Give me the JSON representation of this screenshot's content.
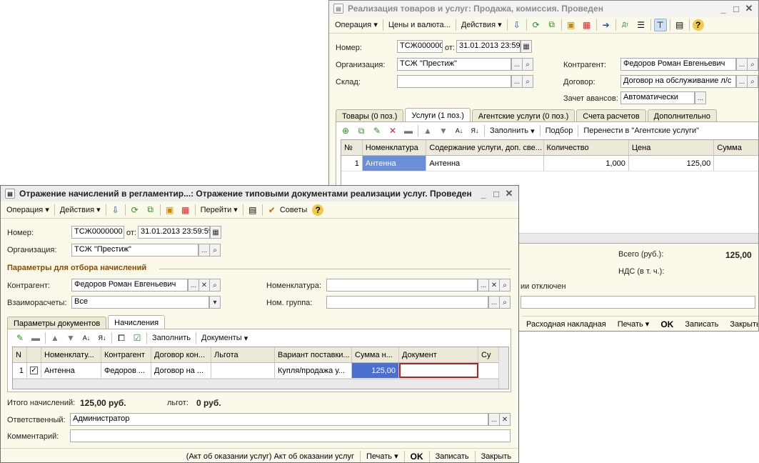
{
  "win1": {
    "title": "Реализация товаров и услуг: Продажа, комиссия. Проведен",
    "toolbar": {
      "operation": "Операция",
      "prices": "Цены и валюта...",
      "actions": "Действия"
    },
    "number_label": "Номер:",
    "number": "ТСЖ000000",
    "date_label": "от:",
    "date": "31.01.2013 23:59",
    "org_label": "Организация:",
    "org": "ТСЖ \"Престиж\"",
    "warehouse_label": "Склад:",
    "contractor_label": "Контрагент:",
    "contractor": "Федоров Роман Евгеньевич",
    "contract_label": "Договор:",
    "contract": "Договор на обслуживание л/с",
    "advance_label": "Зачет авансов:",
    "advance": "Автоматически",
    "tabs": [
      "Товары (0 поз.)",
      "Услуги (1 поз.)",
      "Агентские услуги (0 поз.)",
      "Счета расчетов",
      "Дополнительно"
    ],
    "grid_toolbar": {
      "fill": "Заполнить",
      "selection": "Подбор",
      "transfer": "Перенести в \"Агентские услуги\""
    },
    "grid_headers": [
      "№",
      "Номенклатура",
      "Содержание услуги, доп. све...",
      "Количество",
      "Цена",
      "Сумма"
    ],
    "grid_rows": [
      {
        "n": "1",
        "item": "Антенна",
        "content": "Антенна",
        "qty": "1,000",
        "price": "125,00"
      }
    ],
    "total_label": "Всего (руб.):",
    "total": "125,00",
    "vat_label": "НДС (в т. ч.):",
    "vat_note": "ии отключен",
    "bottom": {
      "invoice": "Расходная накладная",
      "print": "Печать",
      "ok": "OK",
      "save": "Записать",
      "close": "Закрыть"
    }
  },
  "win2": {
    "title": "Отражение начислений в регламентир...: Отражение типовыми документами реализации услуг. Проведен",
    "toolbar": {
      "operation": "Операция",
      "actions": "Действия",
      "goto": "Перейти",
      "tips": "Советы"
    },
    "number_label": "Номер:",
    "number": "ТСЖ0000000",
    "date_label": "от:",
    "date": "31.01.2013 23:59:59",
    "org_label": "Организация:",
    "org": "ТСЖ \"Престиж\"",
    "section": "Параметры для отбора начислений",
    "contractor_label": "Контрагент:",
    "contractor": "Федоров Роман Евгеньевич",
    "settlements_label": "Взаиморасчеты:",
    "settlements": "Все",
    "nomenclature_label": "Номенклатура:",
    "nomgroup_label": "Ном. группа:",
    "tabs": [
      "Параметры документов",
      "Начисления"
    ],
    "grid_toolbar": {
      "fill": "Заполнить",
      "documents": "Документы"
    },
    "grid_headers": [
      "N",
      "",
      "Номенклату...",
      "Контрагент",
      "Договор кон...",
      "Льгота",
      "Вариант поставки...",
      "Сумма н...",
      "Документ",
      "Су"
    ],
    "grid_rows": [
      {
        "n": "1",
        "item": "Антенна",
        "contractor": "Федоров ...",
        "contract": "Договор на ...",
        "benefit": "",
        "variant": "Купля/продажа у...",
        "sum": "125,00",
        "doc": ""
      }
    ],
    "totals_label": "Итого начислений:",
    "totals": "125,00 руб.",
    "benefits_label": "льгот:",
    "benefits": "0 руб.",
    "responsible_label": "Ответственный:",
    "responsible": "Администратор",
    "comment_label": "Комментарий:",
    "bottom": {
      "act": "(Акт об оказании услуг) Акт об оказании услуг",
      "print": "Печать",
      "ok": "OK",
      "save": "Записать",
      "close": "Закрыть"
    }
  }
}
